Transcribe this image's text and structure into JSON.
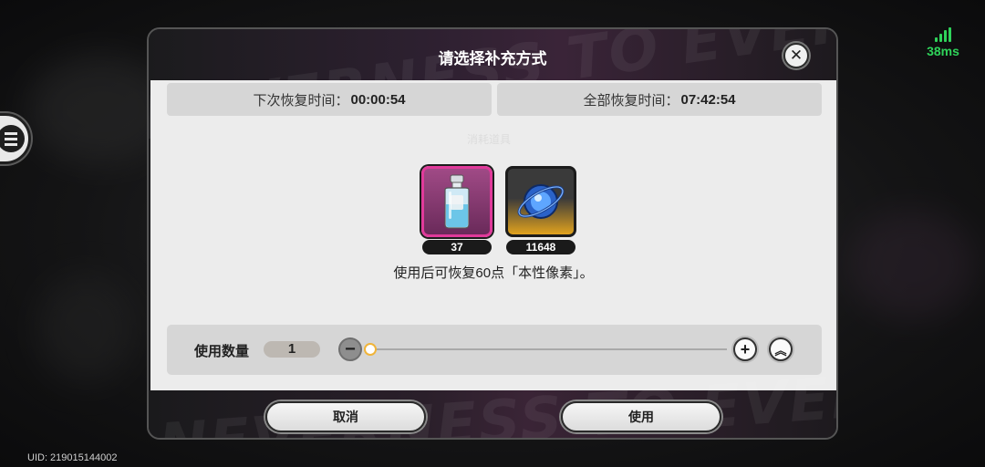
{
  "status": {
    "ping": "38ms",
    "uid": "UID: 219015144002"
  },
  "dialog": {
    "title": "请选择补充方式",
    "deco_text": "NEVERNESS TO EVERNESS",
    "next_recovery_label": "下次恢复时间：",
    "next_recovery_time": "00:00:54",
    "full_recovery_label": "全部恢复时间：",
    "full_recovery_time": "07:42:54",
    "faint_label": "消耗道具",
    "items": [
      {
        "name": "potion-bottle",
        "count": "37",
        "selected": true,
        "frame_color": "#e03a9a"
      },
      {
        "name": "blue-crystal-orb",
        "count": "11648",
        "selected": false,
        "frame_color": "#e0a21e"
      }
    ],
    "description": "使用后可恢复60点「本性像素」。",
    "quantity_label": "使用数量",
    "quantity_value": "1",
    "cancel_label": "取消",
    "use_label": "使用"
  },
  "icons": {
    "minus": "−",
    "plus": "+",
    "max": "︽",
    "close": "✕"
  },
  "colors": {
    "ping": "#2fd35a",
    "slider_thumb": "#f0b43a"
  }
}
